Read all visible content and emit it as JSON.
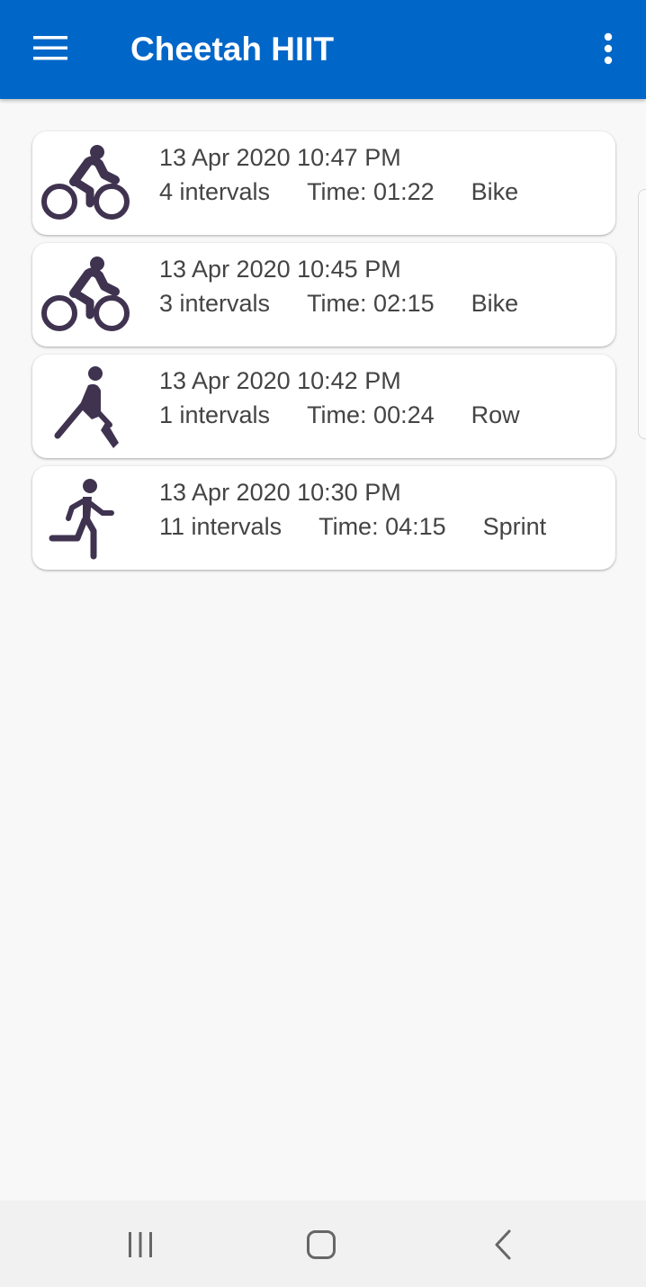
{
  "app_bar": {
    "title": "Cheetah HIIT",
    "background_color": "#0066c8",
    "menu_icon": "hamburger-menu-icon",
    "overflow_icon": "more-vert-icon"
  },
  "sessions": [
    {
      "icon": "bike-icon",
      "date": "13 Apr 2020 10:47 PM",
      "intervals": "4 intervals",
      "time": "Time: 01:22",
      "type": "Bike"
    },
    {
      "icon": "bike-icon",
      "date": "13 Apr 2020 10:45 PM",
      "intervals": "3 intervals",
      "time": "Time: 02:15",
      "type": "Bike"
    },
    {
      "icon": "rowing-icon",
      "date": "13 Apr 2020 10:42 PM",
      "intervals": "1 intervals",
      "time": "Time: 00:24",
      "type": "Row"
    },
    {
      "icon": "sprint-icon",
      "date": "13 Apr 2020 10:30 PM",
      "intervals": "11 intervals",
      "time": "Time: 04:15",
      "type": "Sprint"
    }
  ],
  "icon_color": "#3f3350",
  "nav_bar": {
    "recents_icon": "recents-icon",
    "home_icon": "home-icon",
    "back_icon": "back-icon"
  }
}
